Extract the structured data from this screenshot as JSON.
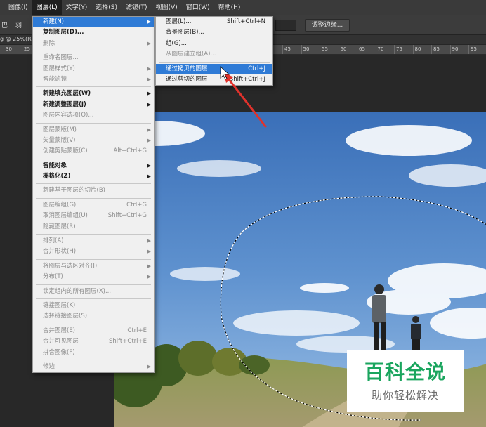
{
  "menubar": {
    "items": [
      "图像(I)",
      "图层(L)",
      "文字(Y)",
      "选择(S)",
      "滤镜(T)",
      "视图(V)",
      "窗口(W)",
      "帮助(H)"
    ],
    "active_index": 1
  },
  "options_bar": {
    "left_text": "巴",
    "left_text2": "羽",
    "adjust_edge_button": "调整边缘..."
  },
  "doc_tab": {
    "label": "g @ 25%(R"
  },
  "ruler": {
    "left_labels": [
      "30",
      "25"
    ],
    "right_labels": [
      "45",
      "50",
      "55",
      "60",
      "65",
      "70",
      "75",
      "80",
      "85",
      "90",
      "95"
    ]
  },
  "main_menu": {
    "items": [
      {
        "label": "新建(N)",
        "shortcut": "",
        "submenu": true,
        "state": "highlight"
      },
      {
        "label": "复制图层(D)...",
        "shortcut": "",
        "submenu": false,
        "state": "bold"
      },
      {
        "label": "删除",
        "shortcut": "",
        "submenu": true,
        "state": "disabled"
      },
      {
        "sep": true
      },
      {
        "label": "重命名图层...",
        "shortcut": "",
        "submenu": false,
        "state": "disabled"
      },
      {
        "label": "图层样式(Y)",
        "shortcut": "",
        "submenu": true,
        "state": "disabled"
      },
      {
        "label": "智能滤镜",
        "shortcut": "",
        "submenu": true,
        "state": "disabled"
      },
      {
        "sep": true
      },
      {
        "label": "新建填充图层(W)",
        "shortcut": "",
        "submenu": true,
        "state": "bold"
      },
      {
        "label": "新建调整图层(J)",
        "shortcut": "",
        "submenu": true,
        "state": "bold"
      },
      {
        "label": "图层内容选项(O)...",
        "shortcut": "",
        "submenu": false,
        "state": "disabled"
      },
      {
        "sep": true
      },
      {
        "label": "图层蒙版(M)",
        "shortcut": "",
        "submenu": true,
        "state": "disabled"
      },
      {
        "label": "矢量蒙版(V)",
        "shortcut": "",
        "submenu": true,
        "state": "disabled"
      },
      {
        "label": "创建剪贴蒙版(C)",
        "shortcut": "Alt+Ctrl+G",
        "submenu": false,
        "state": "disabled"
      },
      {
        "sep": true
      },
      {
        "label": "智能对象",
        "shortcut": "",
        "submenu": true,
        "state": "bold"
      },
      {
        "label": "栅格化(Z)",
        "shortcut": "",
        "submenu": true,
        "state": "bold"
      },
      {
        "sep": true
      },
      {
        "label": "新建基于图层的切片(B)",
        "shortcut": "",
        "submenu": false,
        "state": "disabled"
      },
      {
        "sep": true
      },
      {
        "label": "图层编组(G)",
        "shortcut": "Ctrl+G",
        "submenu": false,
        "state": "disabled"
      },
      {
        "label": "取消图层编组(U)",
        "shortcut": "Shift+Ctrl+G",
        "submenu": false,
        "state": "disabled"
      },
      {
        "label": "隐藏图层(R)",
        "shortcut": "",
        "submenu": false,
        "state": "disabled"
      },
      {
        "sep": true
      },
      {
        "label": "排列(A)",
        "shortcut": "",
        "submenu": true,
        "state": "disabled"
      },
      {
        "label": "合并形状(H)",
        "shortcut": "",
        "submenu": true,
        "state": "disabled"
      },
      {
        "sep": true
      },
      {
        "label": "将图层与选区对齐(I)",
        "shortcut": "",
        "submenu": true,
        "state": "disabled"
      },
      {
        "label": "分布(T)",
        "shortcut": "",
        "submenu": true,
        "state": "disabled"
      },
      {
        "sep": true
      },
      {
        "label": "锁定组内的所有图层(X)...",
        "shortcut": "",
        "submenu": false,
        "state": "disabled"
      },
      {
        "sep": true
      },
      {
        "label": "链接图层(K)",
        "shortcut": "",
        "submenu": false,
        "state": "disabled"
      },
      {
        "label": "选择链接图层(S)",
        "shortcut": "",
        "submenu": false,
        "state": "disabled"
      },
      {
        "sep": true
      },
      {
        "label": "合并图层(E)",
        "shortcut": "Ctrl+E",
        "submenu": false,
        "state": "disabled"
      },
      {
        "label": "合并可见图层",
        "shortcut": "Shift+Ctrl+E",
        "submenu": false,
        "state": "disabled"
      },
      {
        "label": "拼合图像(F)",
        "shortcut": "",
        "submenu": false,
        "state": "disabled"
      },
      {
        "sep": true
      },
      {
        "label": "修边",
        "shortcut": "",
        "submenu": true,
        "state": "disabled"
      }
    ]
  },
  "sub_menu": {
    "items": [
      {
        "label": "图层(L)...",
        "shortcut": "Shift+Ctrl+N",
        "state": "normal"
      },
      {
        "label": "背景图层(B)...",
        "shortcut": "",
        "state": "normal"
      },
      {
        "label": "组(G)...",
        "shortcut": "",
        "state": "normal"
      },
      {
        "label": "从图层建立组(A)...",
        "shortcut": "",
        "state": "disabled"
      },
      {
        "sep": true
      },
      {
        "label": "通过拷贝的图层",
        "shortcut": "Ctrl+J",
        "state": "highlight"
      },
      {
        "label": "通过剪切的图层",
        "shortcut": "Shift+Ctrl+J",
        "state": "normal"
      }
    ]
  },
  "watermark": {
    "title": "百科全说",
    "subtitle": "助你轻松解决"
  },
  "colors": {
    "highlight": "#2f7bd6",
    "annotation_arrow": "#e0322c",
    "watermark_green": "#1aa55e"
  }
}
